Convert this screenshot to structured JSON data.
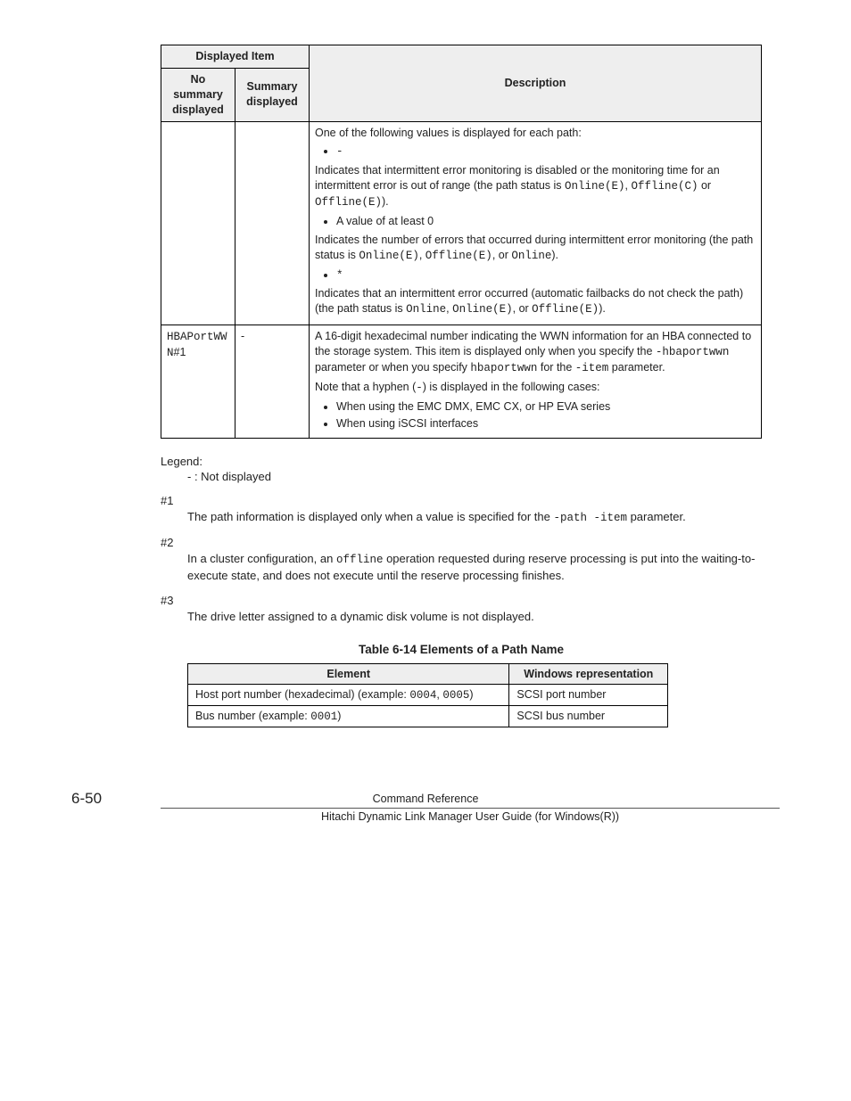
{
  "table1": {
    "headers": {
      "group": "Displayed Item",
      "col1": "No summary displayed",
      "col2": "Summary displayed",
      "col3": "Description"
    },
    "row1": {
      "intro": "One of the following values is displayed for each path:",
      "b1": "-",
      "b1_desc_a": "Indicates that intermittent error monitoring is disabled or the monitoring time for an intermittent error is out of range (the path status is ",
      "b1_desc_code1": "Online(E)",
      "b1_desc_mid1": ", ",
      "b1_desc_code2": "Offline(C)",
      "b1_desc_mid2": " or ",
      "b1_desc_code3": "Offline(E)",
      "b1_desc_end": ").",
      "b2": "A value of at least 0",
      "b2_desc_a": "Indicates the number of errors that occurred during intermittent error monitoring (the path status is ",
      "b2_desc_code1": "Online(E)",
      "b2_desc_mid1": ", ",
      "b2_desc_code2": "Offline(E)",
      "b2_desc_mid2": ", or ",
      "b2_desc_code3": "Online",
      "b2_desc_end": ").",
      "b3": "*",
      "tail_a": "Indicates that an intermittent error occurred (automatic failbacks do not check the path) (the path status is ",
      "tail_code1": "Online",
      "tail_mid1": ", ",
      "tail_code2": "Online(E)",
      "tail_mid2": ", or ",
      "tail_code3": "Offline(E)",
      "tail_end": ")."
    },
    "row2": {
      "c1a": "HBAPortWW",
      "c1b": "N",
      "c1c": "#1",
      "c2": "-",
      "d1a": "A 16-digit hexadecimal number indicating the WWN information for an HBA connected to the storage system. This item is displayed only when you specify the ",
      "d1code1": "-hbaportwwn",
      "d1b": " parameter or when you specify ",
      "d1code2": "hbaportwwn",
      "d1c": " for the ",
      "d1code3": "-item",
      "d1d": " parameter.",
      "d2a": "Note that a hyphen (",
      "d2code": "-",
      "d2b": ") is displayed in the following cases:",
      "li1": "When using the EMC DMX, EMC CX, or HP EVA series",
      "li2": "When using iSCSI interfaces"
    }
  },
  "legend": {
    "title": "Legend:",
    "body": "- : Not displayed"
  },
  "notes": {
    "n1_h": "#1",
    "n1_a": "The path information is displayed only when a value is specified for the ",
    "n1_code1": "-path -item",
    "n1_b": " parameter.",
    "n2_h": "#2",
    "n2_a": "In a cluster configuration, an ",
    "n2_code": "offline",
    "n2_b": " operation requested during reserve processing is put into the waiting-to-execute state, and does not execute until the reserve processing finishes.",
    "n3_h": "#3",
    "n3": "The drive letter assigned to a dynamic disk volume is not displayed."
  },
  "table2": {
    "caption": "Table 6-14 Elements of a Path Name",
    "h1": "Element",
    "h2": "Windows representation",
    "r1c1a": "Host port number (hexadecimal) (example: ",
    "r1c1code": "0004",
    "r1c1mid": ", ",
    "r1c1code2": "0005",
    "r1c1b": ")",
    "r1c2": "SCSI port number",
    "r2c1a": "Bus number (example: ",
    "r2c1code": "0001",
    "r2c1b": ")",
    "r2c2": "SCSI bus number"
  },
  "footer": {
    "page": "6-50",
    "center": "Command Reference",
    "sub": "Hitachi Dynamic Link Manager User Guide (for Windows(R))"
  }
}
